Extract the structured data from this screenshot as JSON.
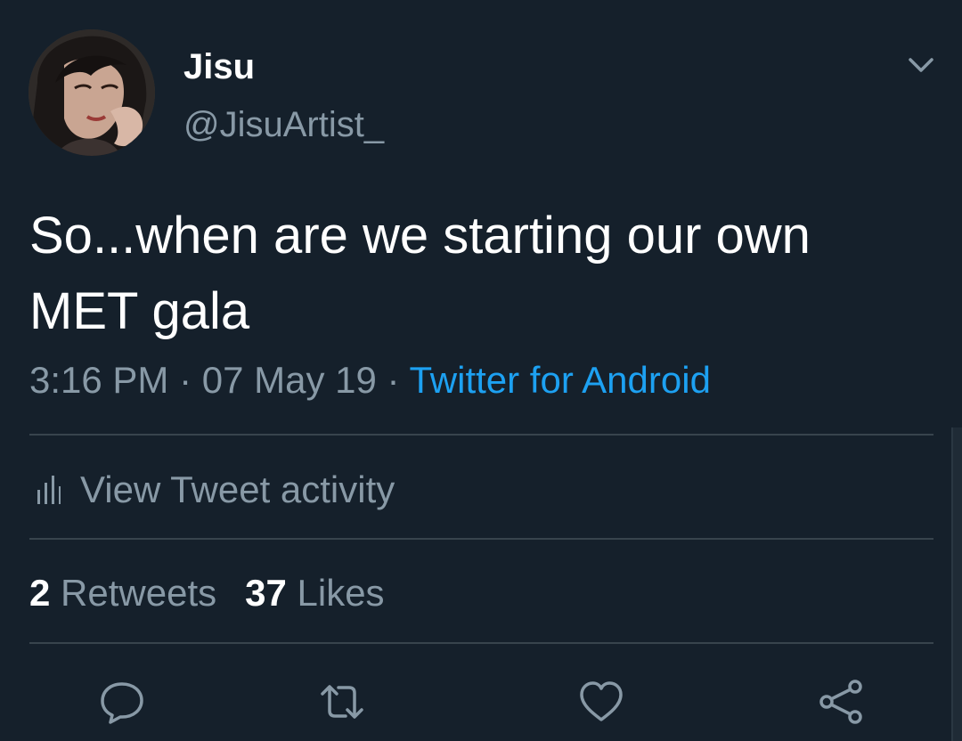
{
  "tweet": {
    "author": {
      "display_name": "Jisu",
      "handle": "@JisuArtist_",
      "avatar_icon": "profile-avatar"
    },
    "text": "So...when are we starting our own MET gala",
    "time": "3:16 PM",
    "separator": " · ",
    "date": "07 May 19",
    "source": "Twitter for Android",
    "activity": {
      "icon": "bar-chart-icon",
      "label": "View Tweet activity"
    },
    "stats": {
      "retweets_count": "2",
      "retweets_label": "Retweets",
      "likes_count": "37",
      "likes_label": "Likes"
    },
    "actions": [
      "reply-icon",
      "retweet-icon",
      "like-icon",
      "share-icon"
    ]
  },
  "colors": {
    "background": "#15202b",
    "text": "#ffffff",
    "secondary_text": "#8899a6",
    "link": "#1da1f2",
    "divider": "#38444d"
  }
}
